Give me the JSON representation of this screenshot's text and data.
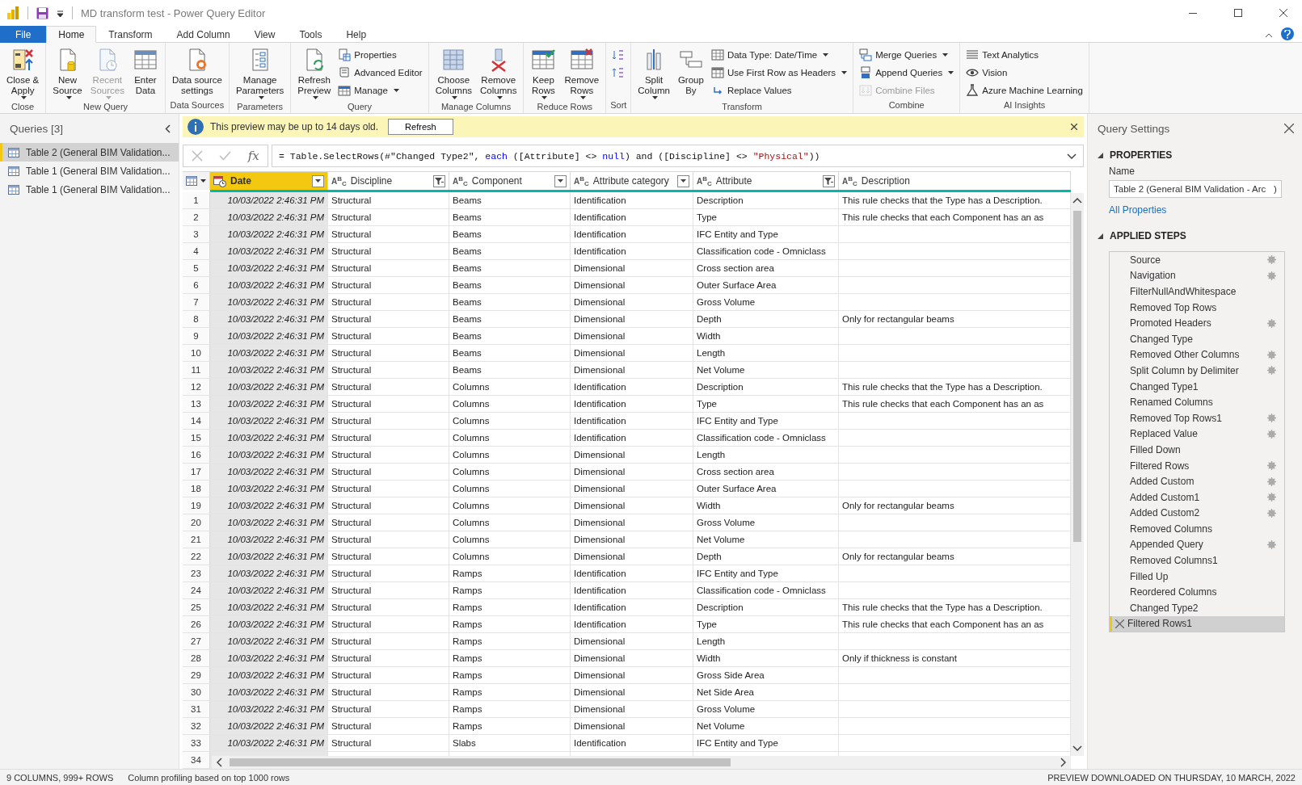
{
  "window": {
    "title": "MD transform test - Power Query Editor"
  },
  "tabs": [
    {
      "label": "File",
      "kind": "file",
      "selected": false
    },
    {
      "label": "Home",
      "kind": "tab",
      "selected": true
    },
    {
      "label": "Transform",
      "kind": "tab",
      "selected": false
    },
    {
      "label": "Add Column",
      "kind": "tab",
      "selected": false
    },
    {
      "label": "View",
      "kind": "tab",
      "selected": false
    },
    {
      "label": "Tools",
      "kind": "tab",
      "selected": false
    },
    {
      "label": "Help",
      "kind": "tab",
      "selected": false
    }
  ],
  "ribbon": {
    "groups": [
      {
        "label": "Close",
        "items": [
          {
            "kind": "large",
            "lines": [
              "Close &",
              "Apply"
            ],
            "dropdown": true,
            "disabled": false
          }
        ]
      },
      {
        "label": "New Query",
        "items": [
          {
            "kind": "large",
            "lines": [
              "New",
              "Source"
            ],
            "dropdown": true,
            "disabled": false
          },
          {
            "kind": "large",
            "lines": [
              "Recent",
              "Sources"
            ],
            "dropdown": true,
            "disabled": true
          },
          {
            "kind": "large",
            "lines": [
              "Enter",
              "Data"
            ],
            "dropdown": false,
            "disabled": false
          }
        ]
      },
      {
        "label": "Data Sources",
        "items": [
          {
            "kind": "large",
            "lines": [
              "Data source",
              "settings"
            ],
            "dropdown": false,
            "disabled": false
          }
        ]
      },
      {
        "label": "Parameters",
        "items": [
          {
            "kind": "large",
            "lines": [
              "Manage",
              "Parameters"
            ],
            "dropdown": true,
            "disabled": false
          }
        ]
      },
      {
        "label": "Query",
        "items": [
          {
            "kind": "large",
            "lines": [
              "Refresh",
              "Preview"
            ],
            "dropdown": true,
            "disabled": false
          },
          {
            "kind": "small",
            "lines": [
              "Properties"
            ],
            "dropdown": false,
            "disabled": false
          },
          {
            "kind": "small",
            "lines": [
              "Advanced Editor"
            ],
            "dropdown": false,
            "disabled": false
          },
          {
            "kind": "small",
            "lines": [
              "Manage"
            ],
            "dropdown": true,
            "disabled": false
          }
        ]
      },
      {
        "label": "Manage Columns",
        "items": [
          {
            "kind": "large",
            "lines": [
              "Choose",
              "Columns"
            ],
            "dropdown": true,
            "disabled": false
          },
          {
            "kind": "large",
            "lines": [
              "Remove",
              "Columns"
            ],
            "dropdown": true,
            "disabled": false
          }
        ]
      },
      {
        "label": "Reduce Rows",
        "items": [
          {
            "kind": "large",
            "lines": [
              "Keep",
              "Rows"
            ],
            "dropdown": true,
            "disabled": false
          },
          {
            "kind": "large",
            "lines": [
              "Remove",
              "Rows"
            ],
            "dropdown": true,
            "disabled": false
          }
        ]
      },
      {
        "label": "Sort",
        "items": [
          {
            "kind": "icon",
            "dropdown": false,
            "disabled": false
          },
          {
            "kind": "icon",
            "dropdown": false,
            "disabled": false
          }
        ]
      },
      {
        "label": "Transform",
        "items": [
          {
            "kind": "large",
            "lines": [
              "Split",
              "Column"
            ],
            "dropdown": true,
            "disabled": false
          },
          {
            "kind": "large",
            "lines": [
              "Group",
              "By"
            ],
            "dropdown": false,
            "disabled": false
          },
          {
            "kind": "small",
            "lines": [
              "Data Type: Date/Time"
            ],
            "dropdown": true,
            "disabled": false
          },
          {
            "kind": "small",
            "lines": [
              "Use First Row as Headers"
            ],
            "dropdown": true,
            "disabled": false
          },
          {
            "kind": "small",
            "lines": [
              "Replace Values"
            ],
            "dropdown": false,
            "disabled": false
          }
        ]
      },
      {
        "label": "Combine",
        "items": [
          {
            "kind": "small",
            "lines": [
              "Merge Queries"
            ],
            "dropdown": true,
            "disabled": false
          },
          {
            "kind": "small",
            "lines": [
              "Append Queries"
            ],
            "dropdown": true,
            "disabled": false
          },
          {
            "kind": "small",
            "lines": [
              "Combine Files"
            ],
            "dropdown": false,
            "disabled": true
          }
        ]
      },
      {
        "label": "AI Insights",
        "items": [
          {
            "kind": "small",
            "lines": [
              "Text Analytics"
            ],
            "dropdown": false,
            "disabled": false
          },
          {
            "kind": "small",
            "lines": [
              "Vision"
            ],
            "dropdown": false,
            "disabled": false
          },
          {
            "kind": "small",
            "lines": [
              "Azure Machine Learning"
            ],
            "dropdown": false,
            "disabled": false
          }
        ]
      }
    ]
  },
  "queries": {
    "title": "Queries [3]",
    "items": [
      {
        "label": "Table 2 (General BIM Validation...",
        "selected": true
      },
      {
        "label": "Table 1 (General BIM Validation...",
        "selected": false
      },
      {
        "label": "Table 1 (General BIM Validation...",
        "selected": false
      }
    ]
  },
  "info_bar": {
    "message": "This preview may be up to 14 days old.",
    "button": "Refresh"
  },
  "formula_bar": {
    "fx": "fx",
    "segments": [
      {
        "kind": "plain",
        "text": "= Table.SelectRows(#\"Changed Type2\", "
      },
      {
        "kind": "keyword",
        "text": "each"
      },
      {
        "kind": "plain",
        "text": " ([Attribute] <> "
      },
      {
        "kind": "keyword",
        "text": "null"
      },
      {
        "kind": "plain",
        "text": ") and ([Discipline] <> "
      },
      {
        "kind": "string",
        "text": "\"Physical\""
      },
      {
        "kind": "plain",
        "text": "))"
      }
    ]
  },
  "table": {
    "columns": [
      {
        "label": "Date",
        "kind": "datetime",
        "selected": true,
        "filtered": false,
        "menu": true
      },
      {
        "label": "Discipline",
        "kind": "text",
        "type_label": "A$^{B}$$_{C}$",
        "selected": false,
        "filtered": true,
        "menu": true
      },
      {
        "label": "Component",
        "kind": "text",
        "type_label": "A$^{B}$$_{C}$",
        "selected": false,
        "filtered": false,
        "menu": true
      },
      {
        "label": "Attribute category",
        "kind": "text",
        "type_label": "A$^{B}$$_{C}$",
        "selected": false,
        "filtered": false,
        "menu": true
      },
      {
        "label": "Attribute",
        "kind": "text",
        "type_label": "A$^{B}$$_{C}$",
        "selected": false,
        "filtered": true,
        "menu": true
      },
      {
        "label": "Description",
        "kind": "text",
        "type_label": "A$^{B}$$_{C}$",
        "selected": false,
        "menu": false
      }
    ],
    "rows": [
      {
        "n": "1",
        "date": "10/03/2022 2:46:31 PM",
        "discipline": "Structural",
        "component": "Beams",
        "attribute_category": "Identification",
        "attribute": "Description",
        "description": "This rule checks that the Type has a Description."
      },
      {
        "n": "2",
        "date": "10/03/2022 2:46:31 PM",
        "discipline": "Structural",
        "component": "Beams",
        "attribute_category": "Identification",
        "attribute": "Type",
        "description": "This rule checks that each Component has an as"
      },
      {
        "n": "3",
        "date": "10/03/2022 2:46:31 PM",
        "discipline": "Structural",
        "component": "Beams",
        "attribute_category": "Identification",
        "attribute": "IFC Entity and Type"
      },
      {
        "n": "4",
        "date": "10/03/2022 2:46:31 PM",
        "discipline": "Structural",
        "component": "Beams",
        "attribute_category": "Identification",
        "attribute": "Classification code - Omniclass"
      },
      {
        "n": "5",
        "date": "10/03/2022 2:46:31 PM",
        "discipline": "Structural",
        "component": "Beams",
        "attribute_category": "Dimensional",
        "attribute": "Cross section area"
      },
      {
        "n": "6",
        "date": "10/03/2022 2:46:31 PM",
        "discipline": "Structural",
        "component": "Beams",
        "attribute_category": "Dimensional",
        "attribute": "Outer Surface Area"
      },
      {
        "n": "7",
        "date": "10/03/2022 2:46:31 PM",
        "discipline": "Structural",
        "component": "Beams",
        "attribute_category": "Dimensional",
        "attribute": "Gross Volume"
      },
      {
        "n": "8",
        "date": "10/03/2022 2:46:31 PM",
        "discipline": "Structural",
        "component": "Beams",
        "attribute_category": "Dimensional",
        "attribute": "Depth",
        "description": "Only for rectangular beams"
      },
      {
        "n": "9",
        "date": "10/03/2022 2:46:31 PM",
        "discipline": "Structural",
        "component": "Beams",
        "attribute_category": "Dimensional",
        "attribute": "Width"
      },
      {
        "n": "10",
        "date": "10/03/2022 2:46:31 PM",
        "discipline": "Structural",
        "component": "Beams",
        "attribute_category": "Dimensional",
        "attribute": "Length"
      },
      {
        "n": "11",
        "date": "10/03/2022 2:46:31 PM",
        "discipline": "Structural",
        "component": "Beams",
        "attribute_category": "Dimensional",
        "attribute": "Net Volume"
      },
      {
        "n": "12",
        "date": "10/03/2022 2:46:31 PM",
        "discipline": "Structural",
        "component": "Columns",
        "attribute_category": "Identification",
        "attribute": "Description",
        "description": "This rule checks that the Type has a Description."
      },
      {
        "n": "13",
        "date": "10/03/2022 2:46:31 PM",
        "discipline": "Structural",
        "component": "Columns",
        "attribute_category": "Identification",
        "attribute": "Type",
        "description": "This rule checks that each Component has an as"
      },
      {
        "n": "14",
        "date": "10/03/2022 2:46:31 PM",
        "discipline": "Structural",
        "component": "Columns",
        "attribute_category": "Identification",
        "attribute": "IFC Entity and Type"
      },
      {
        "n": "15",
        "date": "10/03/2022 2:46:31 PM",
        "discipline": "Structural",
        "component": "Columns",
        "attribute_category": "Identification",
        "attribute": "Classification code - Omniclass"
      },
      {
        "n": "16",
        "date": "10/03/2022 2:46:31 PM",
        "discipline": "Structural",
        "component": "Columns",
        "attribute_category": "Dimensional",
        "attribute": "Length"
      },
      {
        "n": "17",
        "date": "10/03/2022 2:46:31 PM",
        "discipline": "Structural",
        "component": "Columns",
        "attribute_category": "Dimensional",
        "attribute": "Cross section area"
      },
      {
        "n": "18",
        "date": "10/03/2022 2:46:31 PM",
        "discipline": "Structural",
        "component": "Columns",
        "attribute_category": "Dimensional",
        "attribute": "Outer Surface Area"
      },
      {
        "n": "19",
        "date": "10/03/2022 2:46:31 PM",
        "discipline": "Structural",
        "component": "Columns",
        "attribute_category": "Dimensional",
        "attribute": "Width",
        "description": "Only for rectangular beams"
      },
      {
        "n": "20",
        "date": "10/03/2022 2:46:31 PM",
        "discipline": "Structural",
        "component": "Columns",
        "attribute_category": "Dimensional",
        "attribute": "Gross Volume"
      },
      {
        "n": "21",
        "date": "10/03/2022 2:46:31 PM",
        "discipline": "Structural",
        "component": "Columns",
        "attribute_category": "Dimensional",
        "attribute": "Net Volume"
      },
      {
        "n": "22",
        "date": "10/03/2022 2:46:31 PM",
        "discipline": "Structural",
        "component": "Columns",
        "attribute_category": "Dimensional",
        "attribute": "Depth",
        "description": "Only for rectangular beams"
      },
      {
        "n": "23",
        "date": "10/03/2022 2:46:31 PM",
        "discipline": "Structural",
        "component": "Ramps",
        "attribute_category": "Identification",
        "attribute": "IFC Entity and Type"
      },
      {
        "n": "24",
        "date": "10/03/2022 2:46:31 PM",
        "discipline": "Structural",
        "component": "Ramps",
        "attribute_category": "Identification",
        "attribute": "Classification code - Omniclass"
      },
      {
        "n": "25",
        "date": "10/03/2022 2:46:31 PM",
        "discipline": "Structural",
        "component": "Ramps",
        "attribute_category": "Identification",
        "attribute": "Description",
        "description": "This rule checks that the Type has a Description."
      },
      {
        "n": "26",
        "date": "10/03/2022 2:46:31 PM",
        "discipline": "Structural",
        "component": "Ramps",
        "attribute_category": "Identification",
        "attribute": "Type",
        "description": "This rule checks that each Component has an as"
      },
      {
        "n": "27",
        "date": "10/03/2022 2:46:31 PM",
        "discipline": "Structural",
        "component": "Ramps",
        "attribute_category": "Dimensional",
        "attribute": "Length"
      },
      {
        "n": "28",
        "date": "10/03/2022 2:46:31 PM",
        "discipline": "Structural",
        "component": "Ramps",
        "attribute_category": "Dimensional",
        "attribute": "Width",
        "description": "Only if thickness is constant"
      },
      {
        "n": "29",
        "date": "10/03/2022 2:46:31 PM",
        "discipline": "Structural",
        "component": "Ramps",
        "attribute_category": "Dimensional",
        "attribute": "Gross Side Area"
      },
      {
        "n": "30",
        "date": "10/03/2022 2:46:31 PM",
        "discipline": "Structural",
        "component": "Ramps",
        "attribute_category": "Dimensional",
        "attribute": "Net Side Area"
      },
      {
        "n": "31",
        "date": "10/03/2022 2:46:31 PM",
        "discipline": "Structural",
        "component": "Ramps",
        "attribute_category": "Dimensional",
        "attribute": "Gross Volume"
      },
      {
        "n": "32",
        "date": "10/03/2022 2:46:31 PM",
        "discipline": "Structural",
        "component": "Ramps",
        "attribute_category": "Dimensional",
        "attribute": "Net Volume"
      },
      {
        "n": "33",
        "date": "10/03/2022 2:46:31 PM",
        "discipline": "Structural",
        "component": "Slabs",
        "attribute_category": "Identification",
        "attribute": "IFC Entity and Type"
      },
      {
        "n": "34"
      }
    ]
  },
  "query_settings": {
    "title": "Query Settings",
    "properties_heading": "PROPERTIES",
    "name_label": "Name",
    "name_value": "Table 2 (General BIM Validation - Arc   )",
    "all_properties": "All Properties",
    "steps_heading": "APPLIED STEPS",
    "steps": [
      {
        "label": "Source",
        "settings": true,
        "selected": false
      },
      {
        "label": "Navigation",
        "settings": true,
        "selected": false
      },
      {
        "label": "FilterNullAndWhitespace",
        "settings": false,
        "selected": false
      },
      {
        "label": "Removed Top Rows",
        "settings": false,
        "selected": false
      },
      {
        "label": "Promoted Headers",
        "settings": true,
        "selected": false
      },
      {
        "label": "Changed Type",
        "settings": false,
        "selected": false
      },
      {
        "label": "Removed Other Columns",
        "settings": true,
        "selected": false
      },
      {
        "label": "Split Column by Delimiter",
        "settings": true,
        "selected": false
      },
      {
        "label": "Changed Type1",
        "settings": false,
        "selected": false
      },
      {
        "label": "Renamed Columns",
        "settings": false,
        "selected": false
      },
      {
        "label": "Removed Top Rows1",
        "settings": true,
        "selected": false
      },
      {
        "label": "Replaced Value",
        "settings": true,
        "selected": false
      },
      {
        "label": "Filled Down",
        "settings": false,
        "selected": false
      },
      {
        "label": "Filtered Rows",
        "settings": true,
        "selected": false
      },
      {
        "label": "Added Custom",
        "settings": true,
        "selected": false
      },
      {
        "label": "Added Custom1",
        "settings": true,
        "selected": false
      },
      {
        "label": "Added Custom2",
        "settings": true,
        "selected": false
      },
      {
        "label": "Removed Columns",
        "settings": false,
        "selected": false
      },
      {
        "label": "Appended Query",
        "settings": true,
        "selected": false
      },
      {
        "label": "Removed Columns1",
        "settings": false,
        "selected": false
      },
      {
        "label": "Filled Up",
        "settings": false,
        "selected": false
      },
      {
        "label": "Reordered Columns",
        "settings": false,
        "selected": false
      },
      {
        "label": "Changed Type2",
        "settings": false,
        "selected": false
      },
      {
        "label": "Filtered Rows1",
        "settings": false,
        "selected": true
      }
    ]
  },
  "status_bar": {
    "summary": "9 COLUMNS, 999+ ROWS",
    "profiling": "Column profiling based on top 1000 rows",
    "downloaded": "PREVIEW DOWNLOADED ON THURSDAY, 10 MARCH, 2022"
  }
}
